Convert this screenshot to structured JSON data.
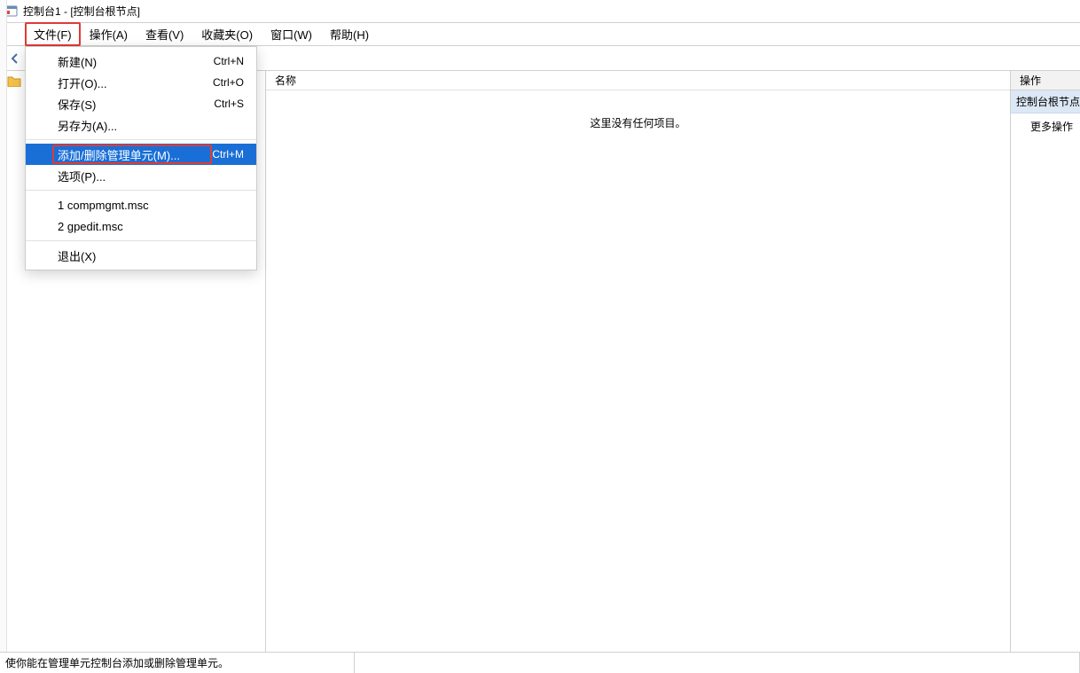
{
  "window": {
    "title": "控制台1 - [控制台根节点]"
  },
  "menubar": {
    "file": "文件(F)",
    "action": "操作(A)",
    "view": "查看(V)",
    "fav": "收藏夹(O)",
    "window": "窗口(W)",
    "help": "帮助(H)"
  },
  "file_menu": {
    "new": {
      "label": "新建(N)",
      "shortcut": "Ctrl+N"
    },
    "open": {
      "label": "打开(O)...",
      "shortcut": "Ctrl+O"
    },
    "save": {
      "label": "保存(S)",
      "shortcut": "Ctrl+S"
    },
    "saveas": {
      "label": "另存为(A)...",
      "shortcut": ""
    },
    "addremove": {
      "label": "添加/删除管理单元(M)...",
      "shortcut": "Ctrl+M"
    },
    "options": {
      "label": "选项(P)...",
      "shortcut": ""
    },
    "recent1": {
      "label": "1 compmgmt.msc",
      "shortcut": ""
    },
    "recent2": {
      "label": "2 gpedit.msc",
      "shortcut": ""
    },
    "exit": {
      "label": "退出(X)",
      "shortcut": ""
    }
  },
  "mid_pane": {
    "col_header": "名称",
    "empty": "这里没有任何项目。"
  },
  "right_pane": {
    "header": "操作",
    "node": "控制台根节点",
    "more": "更多操作"
  },
  "statusbar": {
    "text": "使你能在管理单元控制台添加或删除管理单元。"
  }
}
